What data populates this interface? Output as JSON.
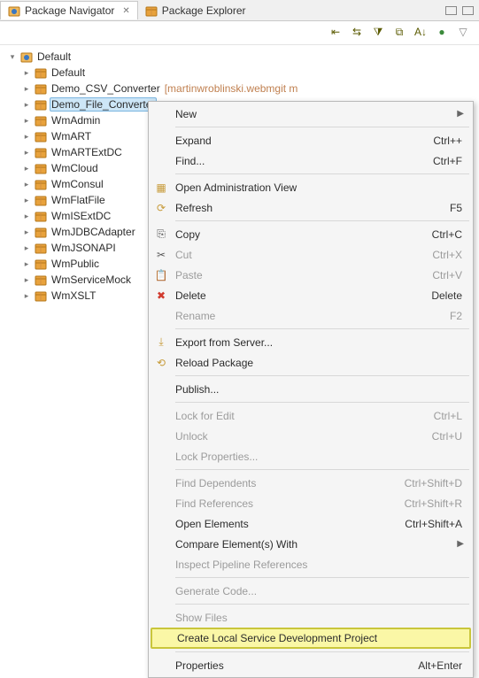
{
  "tabs": {
    "navigator": "Package Navigator",
    "explorer": "Package Explorer"
  },
  "tree": {
    "root": "Default",
    "nodes": [
      {
        "label": "Default",
        "icon": "package"
      },
      {
        "label": "Demo_CSV_Converter",
        "suffix": "[martinwroblinski.webmgit m",
        "icon": "package"
      },
      {
        "label": "Demo_File_Converter",
        "icon": "package",
        "selected": true
      },
      {
        "label": "WmAdmin",
        "icon": "package"
      },
      {
        "label": "WmART",
        "icon": "package"
      },
      {
        "label": "WmARTExtDC",
        "icon": "package"
      },
      {
        "label": "WmCloud",
        "icon": "package"
      },
      {
        "label": "WmConsul",
        "icon": "package"
      },
      {
        "label": "WmFlatFile",
        "icon": "package"
      },
      {
        "label": "WmISExtDC",
        "icon": "package"
      },
      {
        "label": "WmJDBCAdapter",
        "icon": "package"
      },
      {
        "label": "WmJSONAPI",
        "icon": "package"
      },
      {
        "label": "WmPublic",
        "icon": "package"
      },
      {
        "label": "WmServiceMock",
        "icon": "package"
      },
      {
        "label": "WmXSLT",
        "icon": "package"
      }
    ]
  },
  "menu": {
    "new": "New",
    "expand": "Expand",
    "expand_k": "Ctrl++",
    "find": "Find...",
    "find_k": "Ctrl+F",
    "admin": "Open Administration View",
    "refresh": "Refresh",
    "refresh_k": "F5",
    "copy": "Copy",
    "copy_k": "Ctrl+C",
    "cut": "Cut",
    "cut_k": "Ctrl+X",
    "paste": "Paste",
    "paste_k": "Ctrl+V",
    "delete": "Delete",
    "delete_k": "Delete",
    "rename": "Rename",
    "rename_k": "F2",
    "export": "Export from Server...",
    "reload": "Reload Package",
    "publish": "Publish...",
    "lock": "Lock for Edit",
    "lock_k": "Ctrl+L",
    "unlock": "Unlock",
    "unlock_k": "Ctrl+U",
    "lockprops": "Lock Properties...",
    "finddep": "Find Dependents",
    "finddep_k": "Ctrl+Shift+D",
    "findref": "Find References",
    "findref_k": "Ctrl+Shift+R",
    "openel": "Open Elements",
    "openel_k": "Ctrl+Shift+A",
    "compare": "Compare Element(s) With",
    "inspect": "Inspect Pipeline References",
    "gencode": "Generate Code...",
    "showfiles": "Show Files",
    "createlocal": "Create Local Service Development Project",
    "props": "Properties",
    "props_k": "Alt+Enter"
  }
}
